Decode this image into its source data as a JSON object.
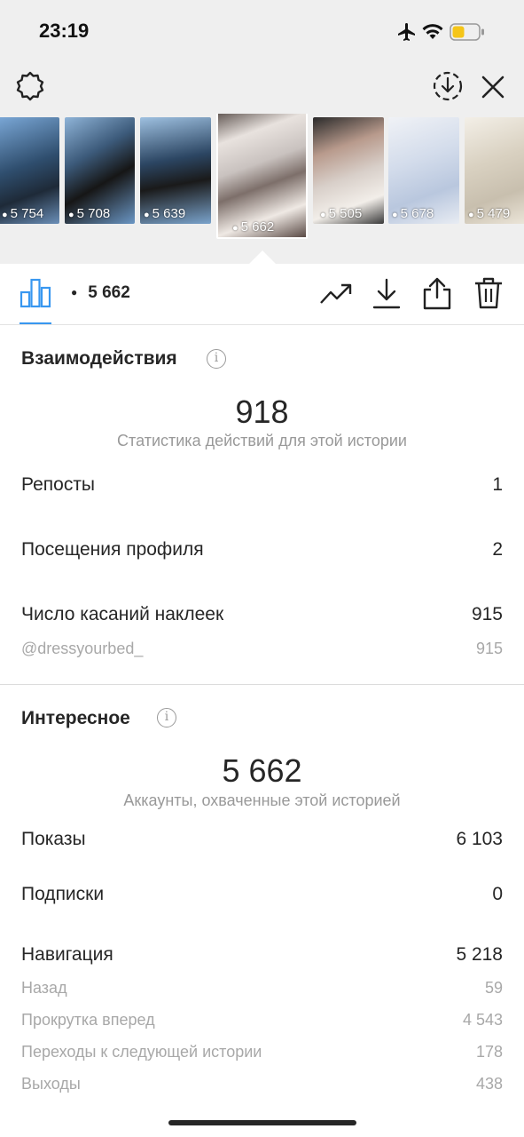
{
  "status": {
    "time": "23:19",
    "icons": [
      "airplane-icon",
      "wifi-icon",
      "battery-icon"
    ]
  },
  "header": {
    "left_icon": "settings-gear-icon",
    "right_icons": [
      "download-circle-icon",
      "close-icon"
    ]
  },
  "thumbnails": [
    {
      "views": "5 754",
      "tag": "#3a6fa8"
    },
    {
      "views": "5 708",
      "tag": "#5a8fc0"
    },
    {
      "views": "5 639",
      "tag": "#d8852f"
    },
    {
      "views": "5 662",
      "tag": "#8a8a8a",
      "selected": true
    },
    {
      "views": "5 505",
      "tag": "#c2185b"
    },
    {
      "views": "5 678",
      "tag": "#9fb6d4"
    },
    {
      "views": "5 479",
      "tag": "#b8b0a0"
    }
  ],
  "toolbar": {
    "active_tab_icon": "bar-chart-icon",
    "views": "5 662",
    "actions": [
      "trend-icon",
      "download-icon",
      "share-icon",
      "trash-icon"
    ]
  },
  "interactions": {
    "title": "Взаимодействия",
    "total": "918",
    "caption": "Статистика действий для этой истории",
    "rows": [
      {
        "label": "Репосты",
        "value": "1"
      },
      {
        "label": "Посещения профиля",
        "value": "2"
      },
      {
        "label": "Число касаний наклеек",
        "value": "915"
      }
    ],
    "sub_rows": [
      {
        "label": "@dressyourbed_",
        "value": "915"
      }
    ]
  },
  "discovery": {
    "title": "Интересное",
    "total": "5 662",
    "caption": "Аккаунты, охваченные этой историей",
    "rows": [
      {
        "label": "Показы",
        "value": "6 103"
      },
      {
        "label": "Подписки",
        "value": "0"
      },
      {
        "label": "Навигация",
        "value": "5 218"
      }
    ],
    "sub_rows": [
      {
        "label": "Назад",
        "value": "59"
      },
      {
        "label": "Прокрутка вперед",
        "value": "4 543"
      },
      {
        "label": "Переходы к следующей истории",
        "value": "178"
      },
      {
        "label": "Выходы",
        "value": "438"
      }
    ]
  },
  "colors": {
    "accent": "#3897f0",
    "top_background": "#efefef"
  }
}
